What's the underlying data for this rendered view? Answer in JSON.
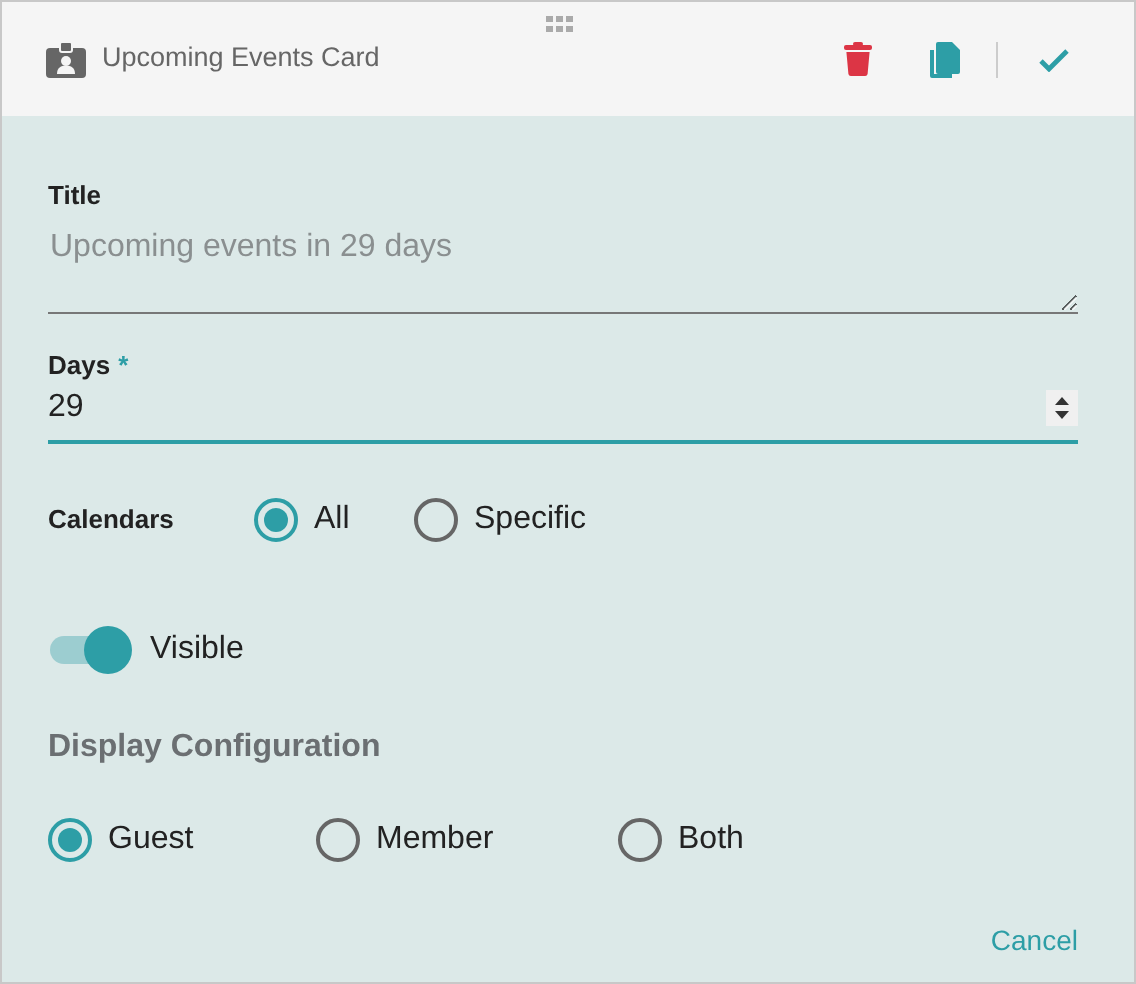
{
  "header": {
    "title": "Upcoming Events Card"
  },
  "title_field": {
    "label": "Title",
    "placeholder": "Upcoming events in 29 days"
  },
  "days_field": {
    "label": "Days",
    "required_mark": "*",
    "value": "29",
    "focused": true
  },
  "calendars": {
    "label": "Calendars",
    "options": [
      {
        "label": "All",
        "selected": true
      },
      {
        "label": "Specific",
        "selected": false
      }
    ]
  },
  "visible_toggle": {
    "label": "Visible",
    "on": true
  },
  "display_configuration": {
    "heading": "Display Configuration",
    "options": [
      {
        "label": "Guest",
        "selected": true
      },
      {
        "label": "Member",
        "selected": false
      },
      {
        "label": "Both",
        "selected": false
      }
    ]
  },
  "cancel": "Cancel"
}
